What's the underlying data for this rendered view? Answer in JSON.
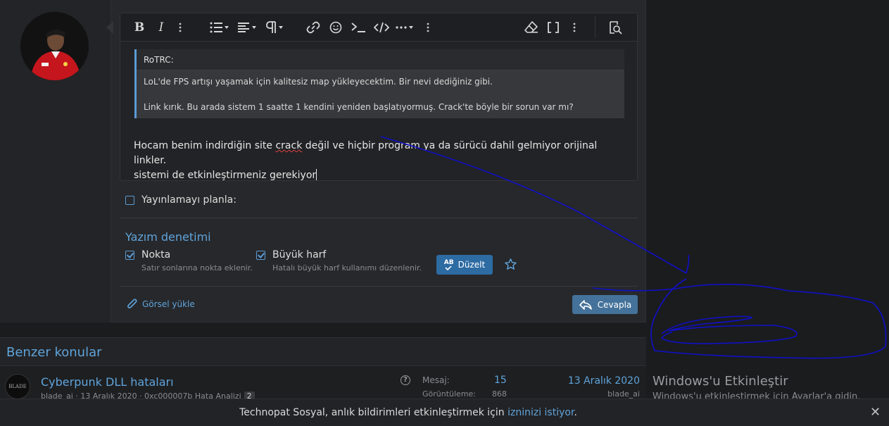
{
  "toolbar": {
    "buttons": [
      "bold",
      "italic",
      "more-text",
      "list",
      "align",
      "paragraph",
      "link",
      "emoji",
      "code-inline",
      "code",
      "more-insert",
      "more",
      "clear-format",
      "bb-code",
      "more-2",
      "preview"
    ]
  },
  "quote": {
    "author": "RoTRC:",
    "line1": "LoL'de FPS artışı yaşamak için kalitesiz map yükleyecektim. Bir nevi dediğiniz gibi.",
    "line2": "Link kırık. Bu arada sistem 1 saatte 1 kendini yeniden başlatıyormuş. Crack'te böyle bir sorun var mı?"
  },
  "reply": {
    "before": "Hocam benim indirdiğin site ",
    "misspelled": "crack",
    "after": " değil ve hiçbir program ya da sürücü dahil gelmiyor orijinal linkler.",
    "line2": "sistemi de etkinleştirmeniz gerekiyor"
  },
  "schedule": {
    "label": "Yayınlamayı planla:",
    "checked": false
  },
  "spellcheck": {
    "title": "Yazım denetimi",
    "options": [
      {
        "label": "Nokta",
        "desc": "Satır sonlarına nokta eklenir.",
        "checked": true
      },
      {
        "label": "Büyük harf",
        "desc": "Hatalı büyük harf kullanımı düzenlenir.",
        "checked": true
      }
    ],
    "fix_label": "Düzelt",
    "ab_label": "AB"
  },
  "footer": {
    "upload_label": "Görsel yükle",
    "reply_label": "Cevapla"
  },
  "similar": {
    "title": "Benzer konular",
    "threads": [
      {
        "avatar_text": "BLADE",
        "title": "Cyberpunk DLL hataları",
        "meta": "blade_ai · 13 Aralık 2020 · 0xc000007b Hata Analizi",
        "meta_badge": "2",
        "reply_label": "Mesaj:",
        "reply_count": "15",
        "view_label": "Görüntüleme:",
        "view_count": "868",
        "last_date": "13 Aralık 2020",
        "last_user": "blade_ai"
      }
    ]
  },
  "windows": {
    "title": "Windows'u Etkinleştir",
    "subtitle": "Windows'u etkinleştirmek için Ayarlar'a gidin."
  },
  "notification": {
    "text_before": "Technopat Sosyal, anlık bildirimleri etkinleştirmek için ",
    "link": "izninizi istiyor",
    "text_after": ".",
    "close": "✕"
  },
  "colors": {
    "accent": "#5fa4db",
    "button": "#2d6ba3",
    "ink": "#1010c8"
  }
}
